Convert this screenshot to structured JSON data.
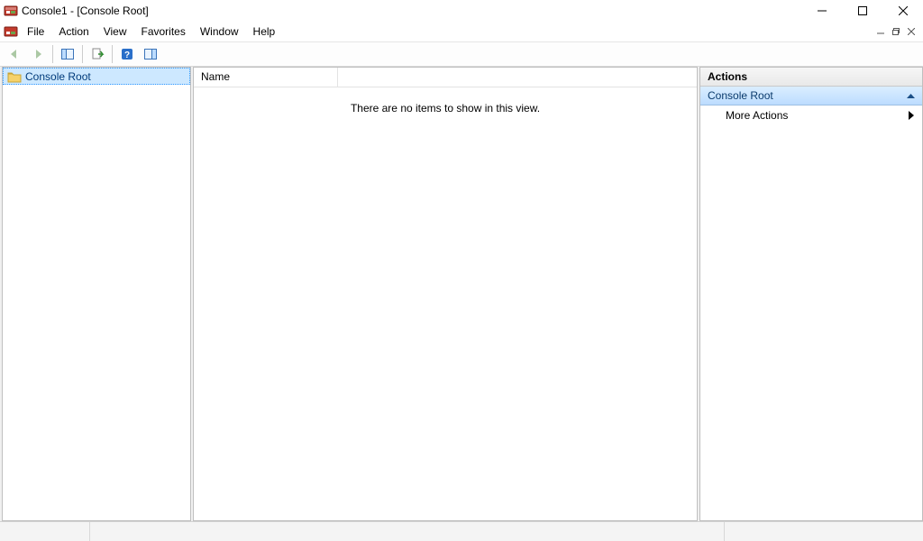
{
  "window": {
    "title": "Console1 - [Console Root]"
  },
  "menu": {
    "file": "File",
    "action": "Action",
    "view": "View",
    "favorites": "Favorites",
    "window": "Window",
    "help": "Help"
  },
  "tree": {
    "root_label": "Console Root"
  },
  "list": {
    "columns": {
      "name": "Name"
    },
    "empty_message": "There are no items to show in this view."
  },
  "actions": {
    "title": "Actions",
    "group_label": "Console Root",
    "more_actions": "More Actions"
  }
}
